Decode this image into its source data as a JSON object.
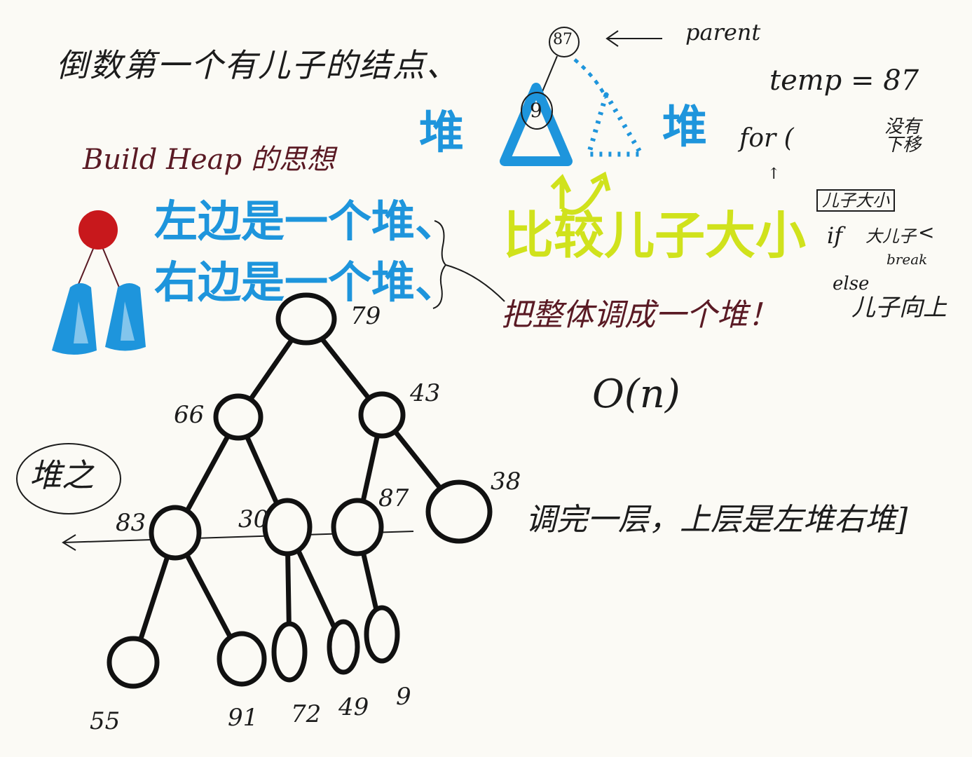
{
  "notes": {
    "title": "倒数第一个有儿子的结点、",
    "build_heap": "Build Heap 的思想",
    "left_heap": "左边是一个堆、",
    "right_heap": "右边是一个堆、",
    "whole_heap": "把整体调成一个堆！",
    "complexity": "O(n)",
    "layer_note": "调完一层，上层是左堆右堆]",
    "circled": "堆之"
  },
  "sketch": {
    "parent_value": "87",
    "child_value": "9",
    "parent_label": "parent",
    "heap_left": "堆",
    "heap_right": "堆",
    "compare": "比较儿子大小",
    "code_temp": "temp = 87",
    "code_for": "for (",
    "code_note": "没有下移",
    "code_box": "儿子大小",
    "code_if": "if",
    "code_if_note": "大儿子",
    "code_break": "break",
    "code_else": "else",
    "code_else_note": "儿子向上"
  },
  "tree": {
    "nodes": [
      "79",
      "66",
      "43",
      "83",
      "30",
      "87",
      "38",
      "55",
      "91",
      "72",
      "49",
      "9"
    ]
  },
  "colors": {
    "ink": "#1c1c1c",
    "maroon": "#5a1a24",
    "blue": "#1e95dc",
    "yellow": "#d0e21c",
    "red": "#c8181c"
  }
}
